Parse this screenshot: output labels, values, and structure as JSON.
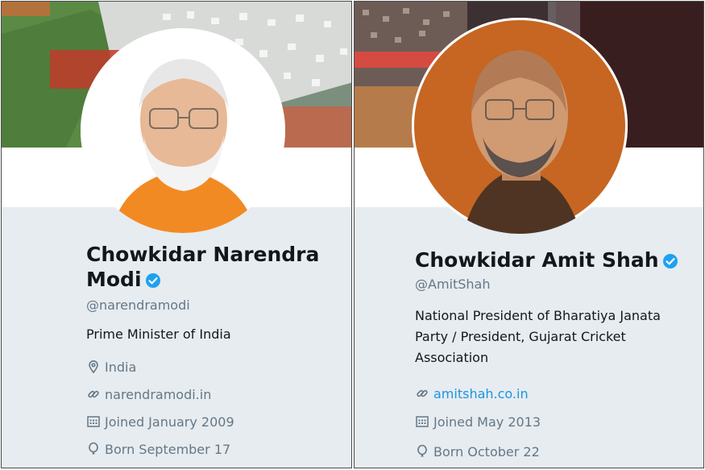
{
  "profiles": [
    {
      "name": "Chowkidar Narendra Modi",
      "handle": "@narendramodi",
      "bio": "Prime Minister of India",
      "location": "India",
      "website": "narendramodi.in",
      "joined": "Joined January 2009",
      "born": "Born September 17"
    },
    {
      "name": "Chowkidar Amit Shah",
      "handle": "@AmitShah",
      "bio": "National President of Bharatiya Janata Party / President, Gujarat Cricket Association",
      "website": "amitshah.co.in",
      "joined": "Joined May 2013",
      "born": "Born October 22"
    }
  ],
  "icons": {
    "verified": "verified-badge-icon",
    "location": "location-pin-icon",
    "link": "link-icon",
    "joined": "calendar-icon",
    "born": "balloon-icon"
  },
  "colors": {
    "card_bg": "#e6ecf0",
    "text": "#14171a",
    "secondary_text": "#657786",
    "link": "#1b95e0",
    "verified": "#1da1f2"
  }
}
